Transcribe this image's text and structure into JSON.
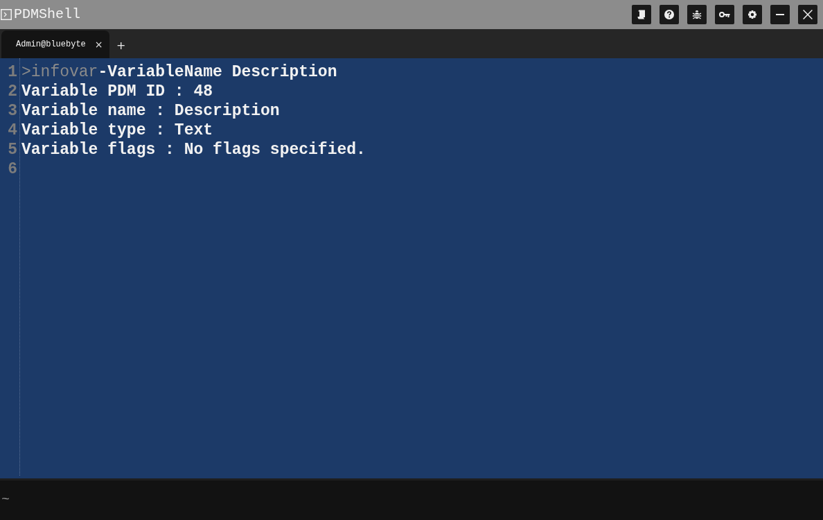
{
  "window": {
    "title": "PDMShell"
  },
  "tabs": [
    {
      "label": "Admin@bluebyte",
      "selected": true,
      "close": "×"
    }
  ],
  "new_tab": "+",
  "editor": {
    "lines": [
      {
        "number": "1",
        "command": ">infovar",
        "text": "-VariableName Description"
      },
      {
        "number": "2",
        "text": "Variable PDM ID : 48"
      },
      {
        "number": "3",
        "text": "Variable name : Description"
      },
      {
        "number": "4",
        "text": "Variable type : Text"
      },
      {
        "number": "5",
        "text": "Variable flags : No flags specified."
      },
      {
        "number": "6"
      }
    ]
  },
  "console": {
    "prompt": "~"
  }
}
